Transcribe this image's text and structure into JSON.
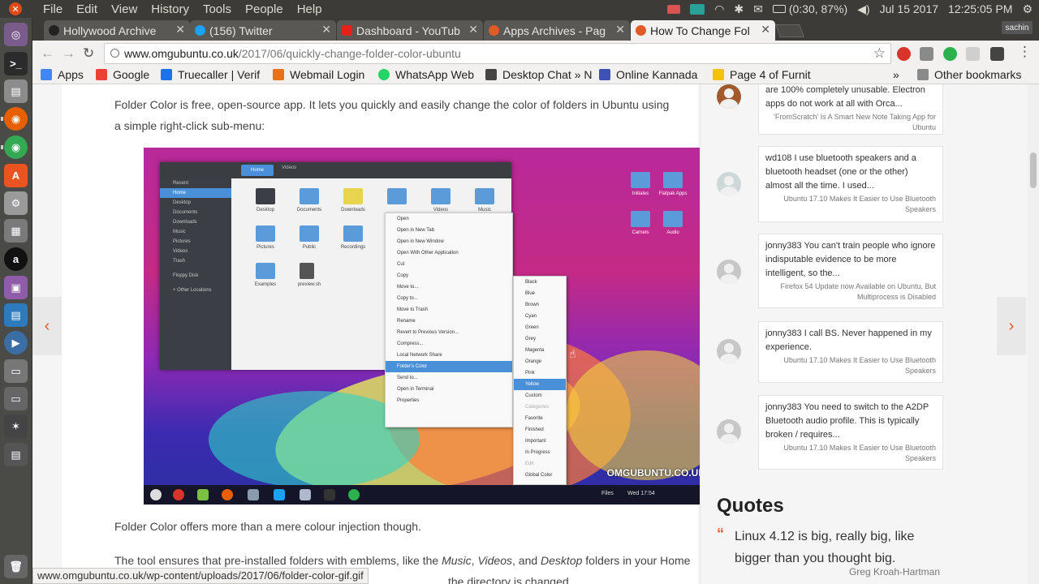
{
  "topbar": {
    "menu": [
      "File",
      "Edit",
      "View",
      "History",
      "Tools",
      "People",
      "Help"
    ],
    "battery": "(0:30, 87%)",
    "date": "Jul 15 2017",
    "time": "12:25:05 PM"
  },
  "tabs": [
    {
      "label": "Hollywood Archive",
      "favicon_color": "#222222"
    },
    {
      "label": "(156) Twitter",
      "favicon_color": "#1da1f2"
    },
    {
      "label": "Dashboard - YouTub",
      "favicon_color": "#e62117"
    },
    {
      "label": "Apps Archives - Pag",
      "favicon_color": "#e05b25"
    },
    {
      "label": "How To Change Fol",
      "favicon_color": "#e05b25"
    }
  ],
  "profile": "sachin",
  "address": {
    "host": "www.omgubuntu.co.uk",
    "path": "/2017/06/quickly-change-folder-color-ubuntu"
  },
  "bookmarks": [
    {
      "label": "Apps",
      "color": "#4285f4"
    },
    {
      "label": "Google",
      "color": "#ea4335"
    },
    {
      "label": "Truecaller | Verif",
      "color": "#1a73e8"
    },
    {
      "label": "Webmail Login",
      "color": "#e8711a"
    },
    {
      "label": "WhatsApp Web",
      "color": "#25d366"
    },
    {
      "label": "Desktop Chat » N",
      "color": "#444444"
    },
    {
      "label": "Online Kannada",
      "color": "#3f51b5"
    },
    {
      "label": "Page 4 of Furnit",
      "color": "#f4c20d"
    }
  ],
  "bookmarks_other": "Other bookmarks",
  "article": {
    "intro": "Folder Color is free, open-source app. It lets you quickly and easily change the color of folders in Ubuntu using a simple right-click sub-menu:",
    "after": "Folder Color offers more than a mere colour injection though.",
    "tool_line_start": "The tool ensures that pre-installed folders with emblems, like the ",
    "music": "Music",
    "comma1": ", ",
    "videos": "Videos",
    "and": ", and ",
    "desktop": "Desktop",
    "tool_line_end": " folders in your Home",
    "last_fragment": "the directory is changed."
  },
  "figure": {
    "files_tab": "Home",
    "files_tab2": "Videos",
    "sidebar": [
      "Recent",
      "Home",
      "Desktop",
      "Documents",
      "Downloads",
      "Music",
      "Pictures",
      "Videos",
      "Trash",
      "Floppy Disk",
      "+ Other Locations"
    ],
    "folders": [
      "Desktop",
      "Documents",
      "Downloads",
      "Videos",
      "Music",
      "Pictures",
      "Public",
      "Recordings",
      "Templates",
      "Examples",
      "preview.sh"
    ],
    "desktop_icons": [
      "Initiales",
      "Flatpak Apps",
      "Carnets",
      "Audio"
    ],
    "menu": [
      "Open",
      "Open in New Tab",
      "Open in New Window",
      "Open With Other Application",
      "Cut",
      "Copy",
      "Move to...",
      "Copy to...",
      "Move to Trash",
      "Rename",
      "Revert to Previous Version...",
      "Compress...",
      "Local Network Share",
      "Folder's Color",
      "Send to...",
      "Open in Terminal",
      "Properties"
    ],
    "colors": [
      "Black",
      "Blue",
      "Brown",
      "Cyan",
      "Green",
      "Grey",
      "Magenta",
      "Orange",
      "Pink",
      "Yellow",
      "Custom",
      "Categories",
      "Favorite",
      "Finished",
      "Important",
      "In Progress",
      "Edit",
      "Global Color"
    ],
    "watermark": "OMGUBUNTU.CO.UK",
    "dock_files": "Files",
    "dock_time": "Wed 17:54"
  },
  "comments": [
    {
      "text": "are 100% completely unusable. Electron apps do not work at all with Orca...",
      "source": "'FromScratch' Is A Smart New Note Taking App for Ubuntu"
    },
    {
      "text": "wd108 I use bluetooth speakers and a bluetooth headset (one or the other) almost all the time. I used...",
      "source": "Ubuntu 17.10 Makes It Easier to Use Bluetooth Speakers"
    },
    {
      "text": "jonny383 You can't train people who ignore indisputable evidence to be more intelligent, so the...",
      "source": "Firefox 54 Update now Available on Ubuntu, But Multiprocess is Disabled"
    },
    {
      "text": "jonny383 I call BS. Never happened in my experience.",
      "source": "Ubuntu 17.10 Makes It Easier to Use Bluetooth Speakers"
    },
    {
      "text": "jonny383 You need to switch to the A2DP Bluetooth audio profile. This is typically broken / requires...",
      "source": "Ubuntu 17.10 Makes It Easier to Use Bluetooth Speakers"
    }
  ],
  "quotes": {
    "heading": "Quotes",
    "text": "Linux 4.12 is big, really big, like bigger than you thought big.",
    "author": "Greg Kroah-Hartman"
  },
  "status_url": "www.omgubuntu.co.uk/wp-content/uploads/2017/06/folder-color-gif.gif",
  "colors": {
    "accent": "#e05b25",
    "panel": "#3c3b37"
  }
}
